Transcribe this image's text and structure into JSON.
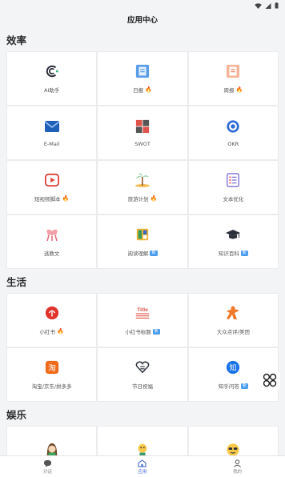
{
  "header": {
    "title": "应用中心"
  },
  "sections": [
    {
      "title": "效率",
      "items": [
        {
          "label": "AI助手",
          "icon": "ai-assistant-icon"
        },
        {
          "label": "日报",
          "icon": "daily-report-icon",
          "hot": true
        },
        {
          "label": "周报",
          "icon": "weekly-report-icon",
          "hot": true
        },
        {
          "label": "E-Mail",
          "icon": "email-icon"
        },
        {
          "label": "SWOT",
          "icon": "swot-icon"
        },
        {
          "label": "OKR",
          "icon": "okr-icon"
        },
        {
          "label": "短视频脚本",
          "icon": "video-script-icon",
          "hot": true
        },
        {
          "label": "旅游计划",
          "icon": "travel-plan-icon",
          "hot": true
        },
        {
          "label": "文本优化",
          "icon": "text-optimize-icon"
        },
        {
          "label": "逃教文",
          "icon": "article-icon"
        },
        {
          "label": "阅读理解",
          "icon": "reading-icon",
          "badge": "新"
        },
        {
          "label": "知识百科",
          "icon": "encyclopedia-icon",
          "badge": "新"
        }
      ]
    },
    {
      "title": "生活",
      "items": [
        {
          "label": "小红书",
          "icon": "xiaohongshu-icon",
          "hot": true
        },
        {
          "label": "小红书标题",
          "icon": "title-icon",
          "badge": "新"
        },
        {
          "label": "大众点评/美团",
          "icon": "review-icon"
        },
        {
          "label": "淘宝/京东/拼多多",
          "icon": "shopping-icon"
        },
        {
          "label": "节日祝福",
          "icon": "holiday-greeting-icon"
        },
        {
          "label": "知乎问答",
          "icon": "zhihu-icon",
          "badge": "新"
        }
      ]
    },
    {
      "title": "娱乐",
      "items": [
        {
          "label": "",
          "icon": "avatar-girl-icon"
        },
        {
          "label": "",
          "icon": "cartoon-icon"
        },
        {
          "label": "",
          "icon": "emoji-cool-icon"
        }
      ]
    }
  ],
  "bottom_nav": [
    {
      "label": "对话",
      "icon": "chat-icon",
      "active": false
    },
    {
      "label": "应用",
      "icon": "home-icon",
      "active": true
    },
    {
      "label": "我的",
      "icon": "profile-icon",
      "active": false
    }
  ],
  "colors": {
    "accent": "#4a6cd6",
    "hot": "#f08c2a",
    "badge": "#4a9df0",
    "background": "#f3f4f6"
  }
}
